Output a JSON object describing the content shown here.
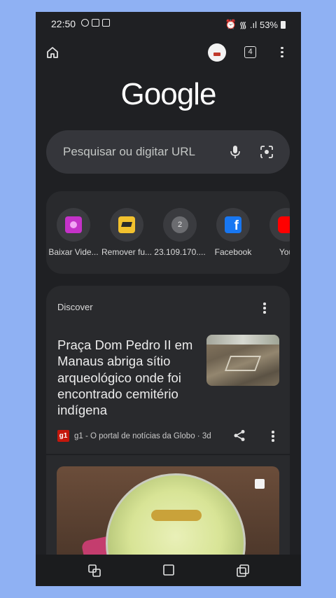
{
  "status": {
    "time": "22:50",
    "battery": "53%"
  },
  "toolbar": {
    "tab_count": "4"
  },
  "logo": "Google",
  "search": {
    "placeholder": "Pesquisar ou digitar URL"
  },
  "shortcuts": [
    {
      "label": "Baixar Vide...",
      "icon": "purple-app-icon",
      "color": "#c532c9"
    },
    {
      "label": "Remover fu...",
      "icon": "yellow-layers-icon",
      "color": "#f2c12e"
    },
    {
      "label": "23.109.170....",
      "icon": "letter-2-icon",
      "letter": "2"
    },
    {
      "label": "Facebook",
      "icon": "facebook-icon",
      "color": "#1877f2"
    },
    {
      "label": "You",
      "icon": "youtube-icon",
      "color": "#ff0000"
    }
  ],
  "discover": {
    "title": "Discover",
    "article": {
      "headline": "Praça Dom Pedro II em Manaus abriga sítio arqueológico onde foi encontrado cemitério indígena",
      "source_badge": "g1",
      "source": "g1 - O portal de notícias da Globo · 3d"
    }
  }
}
